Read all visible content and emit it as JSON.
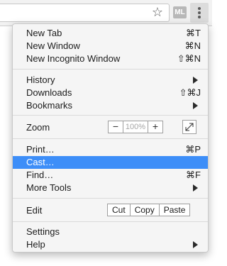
{
  "toolbar": {
    "star_icon": "star-outline-icon",
    "extension_badge": "ML",
    "menu_icon": "three-dots-vertical-icon"
  },
  "menu": {
    "new_tab": {
      "label": "New Tab",
      "shortcut": "⌘T"
    },
    "new_window": {
      "label": "New Window",
      "shortcut": "⌘N"
    },
    "new_incognito": {
      "label": "New Incognito Window",
      "shortcut": "⇧⌘N"
    },
    "history": {
      "label": "History",
      "submenu": true
    },
    "downloads": {
      "label": "Downloads",
      "shortcut": "⇧⌘J"
    },
    "bookmarks": {
      "label": "Bookmarks",
      "submenu": true
    },
    "zoom": {
      "label": "Zoom",
      "minus": "−",
      "value": "100%",
      "plus": "+",
      "fullscreen_icon": "fullscreen-icon"
    },
    "print": {
      "label": "Print…",
      "shortcut": "⌘P"
    },
    "cast": {
      "label": "Cast…",
      "highlighted": true
    },
    "find": {
      "label": "Find…",
      "shortcut": "⌘F"
    },
    "more_tools": {
      "label": "More Tools",
      "submenu": true
    },
    "edit": {
      "label": "Edit",
      "cut": "Cut",
      "copy": "Copy",
      "paste": "Paste"
    },
    "settings": {
      "label": "Settings"
    },
    "help": {
      "label": "Help",
      "submenu": true
    }
  },
  "colors": {
    "highlight": "#3d8ef8",
    "menu_bg": "#f5f5f5",
    "toolbar_bg": "#f2f2f2"
  }
}
